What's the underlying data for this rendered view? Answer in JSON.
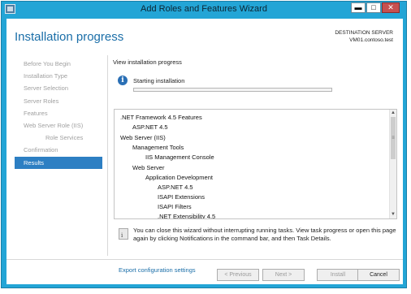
{
  "window": {
    "title": "Add Roles and Features Wizard",
    "min_glyph": "▬",
    "max_glyph": "□",
    "close_glyph": "✕"
  },
  "page": {
    "title": "Installation progress",
    "destination_label": "DESTINATION SERVER",
    "destination_server": "VM01.contoso.test"
  },
  "nav": {
    "items": [
      {
        "label": "Before You Begin"
      },
      {
        "label": "Installation Type"
      },
      {
        "label": "Server Selection"
      },
      {
        "label": "Server Roles"
      },
      {
        "label": "Features"
      },
      {
        "label": "Web Server Role (IIS)"
      },
      {
        "label": "Role Services"
      },
      {
        "label": "Confirmation"
      },
      {
        "label": "Results"
      }
    ],
    "active": "Results"
  },
  "main": {
    "view_label": "View installation progress",
    "info_glyph": "i",
    "status": "Starting installation",
    "progress_fraction": 0.0,
    "features": [
      {
        "label": ".NET Framework 4.5 Features",
        "level": 0
      },
      {
        "label": "ASP.NET 4.5",
        "level": 1
      },
      {
        "label": "Web Server (IIS)",
        "level": 0
      },
      {
        "label": "Management Tools",
        "level": 1
      },
      {
        "label": "IIS Management Console",
        "level": 2
      },
      {
        "label": "Web Server",
        "level": 1
      },
      {
        "label": "Application Development",
        "level": 2
      },
      {
        "label": "ASP.NET 4.5",
        "level": 3
      },
      {
        "label": "ISAPI Extensions",
        "level": 3
      },
      {
        "label": "ISAPI Filters",
        "level": 3
      },
      {
        "label": ".NET Extensibility 4.5",
        "level": 3
      }
    ],
    "scroll": {
      "up": "▲",
      "down": "▼",
      "thumb": "≡"
    },
    "note": "You can close this wizard without interrupting running tasks. View task progress or open this page again by clicking Notifications in the command bar, and then Task Details.",
    "export_link": "Export configuration settings"
  },
  "buttons": {
    "previous": "< Previous",
    "next": "Next >",
    "install": "Install",
    "cancel": "Cancel"
  },
  "colors": {
    "accent": "#1a6ea8",
    "frame": "#23a5d6",
    "nav_active": "#2d7fc3",
    "progress": "#16a04a"
  }
}
